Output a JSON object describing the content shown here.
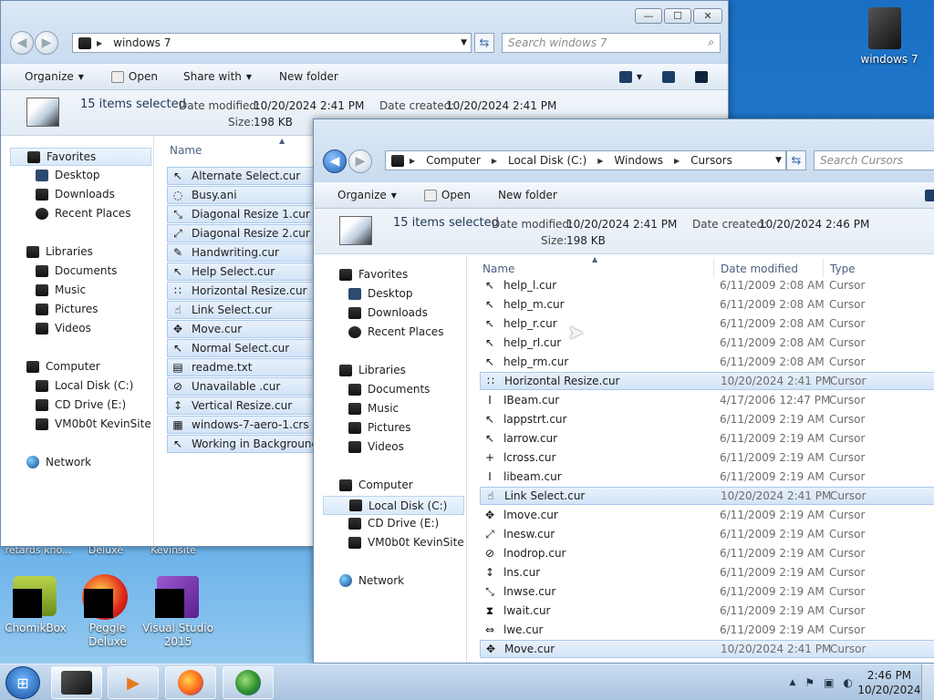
{
  "desktop": {
    "top_icon_label": "windows 7",
    "partial_labels": [
      "retards kno...",
      "Deluxe",
      "Kevinsite"
    ],
    "icons": [
      {
        "label": "ChomikBox"
      },
      {
        "label": "Peggle Deluxe"
      },
      {
        "label": "Visual Studio 2015"
      }
    ]
  },
  "win1": {
    "caption": {
      "minimize": "—",
      "maximize": "☐",
      "close": "✕"
    },
    "address": "windows 7",
    "search_placeholder": "Search windows 7",
    "toolbar": {
      "organize": "Organize",
      "open": "Open",
      "share_with": "Share with",
      "new_folder": "New folder"
    },
    "details": {
      "selected": "15 items selected",
      "modified_label": "Date modified:",
      "modified": "10/20/2024 2:41 PM",
      "created_label": "Date created:",
      "created": "10/20/2024 2:41 PM",
      "size_label": "Size:",
      "size": "198 KB"
    },
    "nav": {
      "favorites": "Favorites",
      "desktop": "Desktop",
      "downloads": "Downloads",
      "recent": "Recent Places",
      "libraries": "Libraries",
      "documents": "Documents",
      "music": "Music",
      "pictures": "Pictures",
      "videos": "Videos",
      "computer": "Computer",
      "local_disk": "Local Disk (C:)",
      "cd_drive": "CD Drive (E:)",
      "vm": "VM0b0t KevinSite",
      "network": "Network"
    },
    "column_name": "Name",
    "files": [
      {
        "name": "Alternate Select.cur",
        "icon": "↖"
      },
      {
        "name": "Busy.ani",
        "icon": "◌"
      },
      {
        "name": "Diagonal Resize 1.cur",
        "icon": "⤡"
      },
      {
        "name": "Diagonal Resize 2.cur",
        "icon": "⤢"
      },
      {
        "name": "Handwriting.cur",
        "icon": "✎"
      },
      {
        "name": "Help Select.cur",
        "icon": "↖"
      },
      {
        "name": "Horizontal Resize.cur",
        "icon": "∷"
      },
      {
        "name": "Link Select.cur",
        "icon": "☝"
      },
      {
        "name": "Move.cur",
        "icon": "✥"
      },
      {
        "name": "Normal Select.cur",
        "icon": "↖"
      },
      {
        "name": "readme.txt",
        "icon": "▤"
      },
      {
        "name": "Unavailable .cur",
        "icon": "⊘"
      },
      {
        "name": "Vertical Resize.cur",
        "icon": "↕"
      },
      {
        "name": "windows-7-aero-1.crs",
        "icon": "▦"
      },
      {
        "name": "Working in Background.ani",
        "icon": "↖"
      }
    ]
  },
  "win2": {
    "address": [
      "Computer",
      "Local Disk (C:)",
      "Windows",
      "Cursors"
    ],
    "search_placeholder": "Search Cursors",
    "toolbar": {
      "organize": "Organize",
      "open": "Open",
      "new_folder": "New folder"
    },
    "details": {
      "selected": "15 items selected",
      "modified_label": "Date modified:",
      "modified": "10/20/2024 2:41 PM",
      "created_label": "Date created:",
      "created": "10/20/2024 2:46 PM",
      "size_label": "Size:",
      "size": "198 KB"
    },
    "nav": {
      "favorites": "Favorites",
      "desktop": "Desktop",
      "downloads": "Downloads",
      "recent": "Recent Places",
      "libraries": "Libraries",
      "documents": "Documents",
      "music": "Music",
      "pictures": "Pictures",
      "videos": "Videos",
      "computer": "Computer",
      "local_disk": "Local Disk (C:)",
      "cd_drive": "CD Drive (E:)",
      "vm": "VM0b0t KevinSite",
      "network": "Network"
    },
    "columns": {
      "name": "Name",
      "date": "Date modified",
      "type": "Type"
    },
    "files": [
      {
        "name": "help_l.cur",
        "date": "6/11/2009 2:08 AM",
        "type": "Cursor",
        "icon": "↖",
        "selected": false
      },
      {
        "name": "help_m.cur",
        "date": "6/11/2009 2:08 AM",
        "type": "Cursor",
        "icon": "↖",
        "selected": false
      },
      {
        "name": "help_r.cur",
        "date": "6/11/2009 2:08 AM",
        "type": "Cursor",
        "icon": "↖",
        "selected": false
      },
      {
        "name": "help_rl.cur",
        "date": "6/11/2009 2:08 AM",
        "type": "Cursor",
        "icon": "↖",
        "selected": false
      },
      {
        "name": "help_rm.cur",
        "date": "6/11/2009 2:08 AM",
        "type": "Cursor",
        "icon": "↖",
        "selected": false
      },
      {
        "name": "Horizontal Resize.cur",
        "date": "10/20/2024 2:41 PM",
        "type": "Cursor",
        "icon": "∷",
        "selected": true
      },
      {
        "name": "IBeam.cur",
        "date": "4/17/2006 12:47 PM",
        "type": "Cursor",
        "icon": "I",
        "selected": false
      },
      {
        "name": "lappstrt.cur",
        "date": "6/11/2009 2:19 AM",
        "type": "Cursor",
        "icon": "↖",
        "selected": false
      },
      {
        "name": "larrow.cur",
        "date": "6/11/2009 2:19 AM",
        "type": "Cursor",
        "icon": "↖",
        "selected": false
      },
      {
        "name": "lcross.cur",
        "date": "6/11/2009 2:19 AM",
        "type": "Cursor",
        "icon": "+",
        "selected": false
      },
      {
        "name": "libeam.cur",
        "date": "6/11/2009 2:19 AM",
        "type": "Cursor",
        "icon": "I",
        "selected": false
      },
      {
        "name": "Link Select.cur",
        "date": "10/20/2024 2:41 PM",
        "type": "Cursor",
        "icon": "☝",
        "selected": true
      },
      {
        "name": "lmove.cur",
        "date": "6/11/2009 2:19 AM",
        "type": "Cursor",
        "icon": "✥",
        "selected": false
      },
      {
        "name": "lnesw.cur",
        "date": "6/11/2009 2:19 AM",
        "type": "Cursor",
        "icon": "⤢",
        "selected": false
      },
      {
        "name": "lnodrop.cur",
        "date": "6/11/2009 2:19 AM",
        "type": "Cursor",
        "icon": "⊘",
        "selected": false
      },
      {
        "name": "lns.cur",
        "date": "6/11/2009 2:19 AM",
        "type": "Cursor",
        "icon": "↕",
        "selected": false
      },
      {
        "name": "lnwse.cur",
        "date": "6/11/2009 2:19 AM",
        "type": "Cursor",
        "icon": "⤡",
        "selected": false
      },
      {
        "name": "lwait.cur",
        "date": "6/11/2009 2:19 AM",
        "type": "Cursor",
        "icon": "⧗",
        "selected": false
      },
      {
        "name": "lwe.cur",
        "date": "6/11/2009 2:19 AM",
        "type": "Cursor",
        "icon": "⇔",
        "selected": false
      },
      {
        "name": "Move.cur",
        "date": "10/20/2024 2:41 PM",
        "type": "Cursor",
        "icon": "✥",
        "selected": true
      }
    ]
  },
  "taskbar": {
    "time": "2:46 PM",
    "date": "10/20/2024",
    "tray_up": "▲"
  },
  "colors": {
    "accent": "#3399ff",
    "selection": "#d3e4f7"
  }
}
